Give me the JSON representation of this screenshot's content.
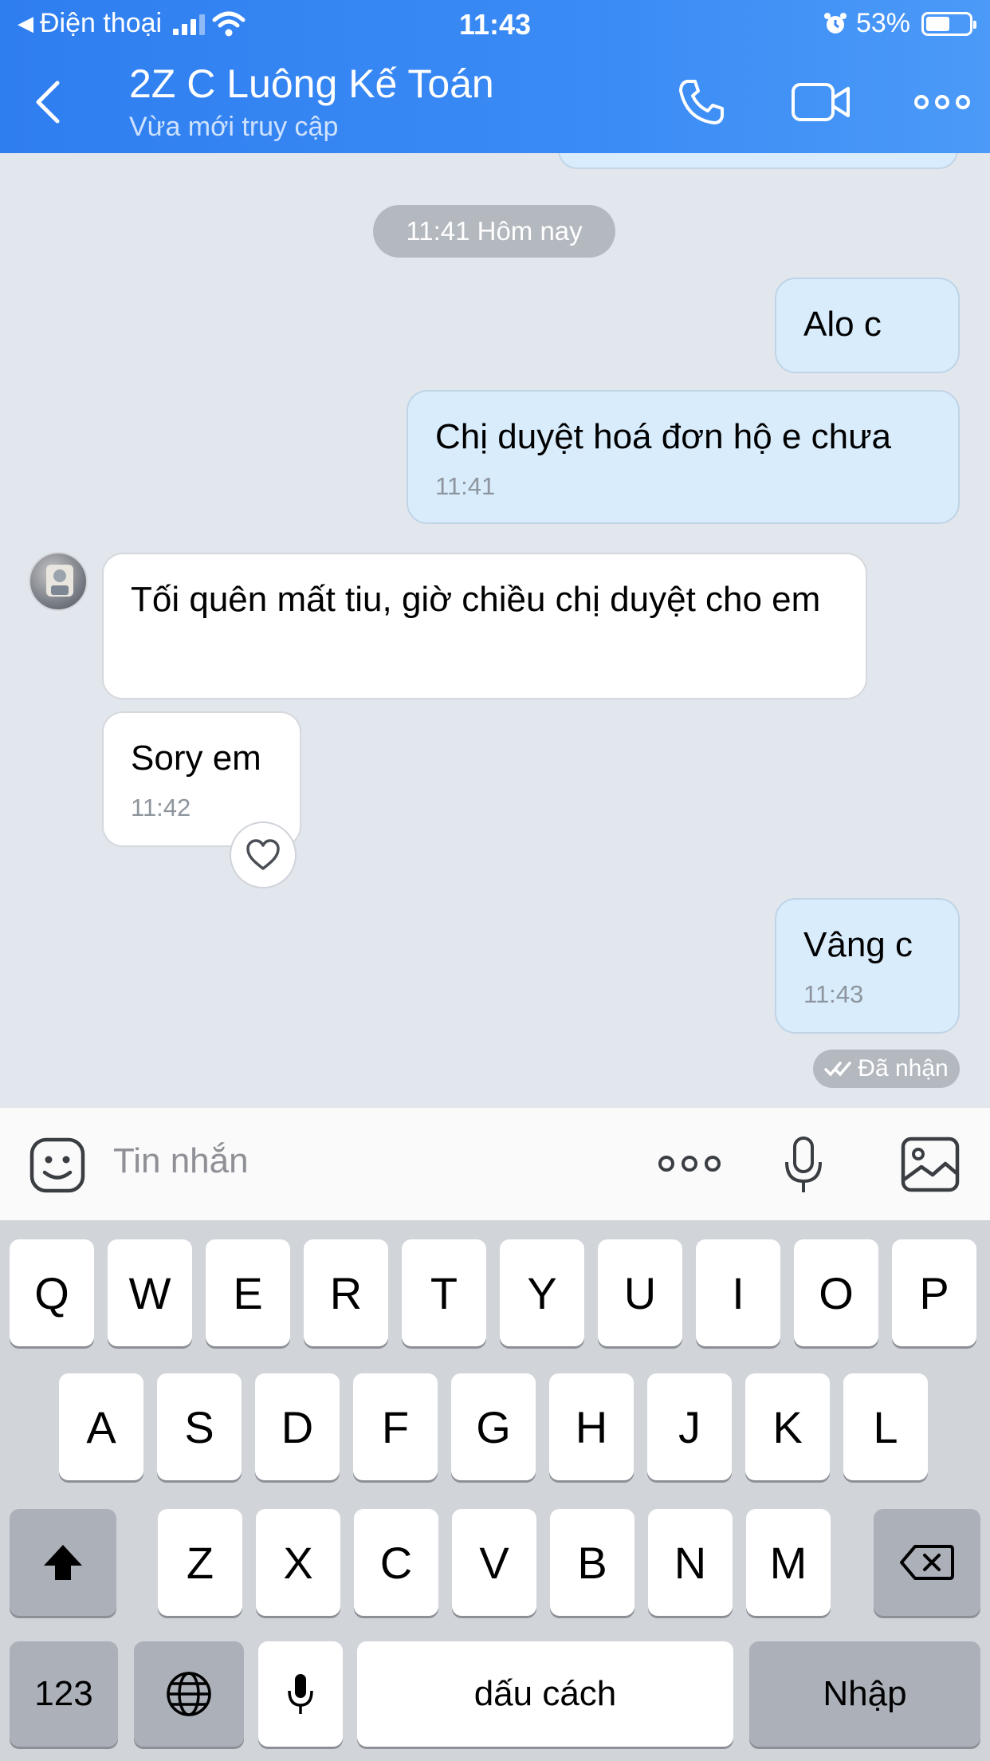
{
  "status_bar": {
    "back_app": "Điện thoại",
    "time": "11:43",
    "battery": "53%"
  },
  "header": {
    "title": "2Z C Luông Kế Toán",
    "subtitle": "Vừa mới truy cập",
    "icons": [
      "back-icon",
      "phone-icon",
      "video-camera-icon",
      "more-icon"
    ]
  },
  "chat": {
    "date_divider": "11:41 Hôm nay",
    "messages": [
      {
        "dir": "out",
        "text": "Alo c",
        "time": ""
      },
      {
        "dir": "out",
        "text": "Chị duyệt hoá đơn hộ e chưa",
        "time": "11:41"
      },
      {
        "dir": "in",
        "text": "Tối quên mất tiu, giờ chiều chị duyệt cho em",
        "time": ""
      },
      {
        "dir": "in",
        "text": "Sory em",
        "time": "11:42"
      },
      {
        "dir": "out",
        "text": "Vâng c",
        "time": "11:43"
      }
    ],
    "receipt": "Đã nhận"
  },
  "input": {
    "placeholder": "Tin nhắn",
    "icons": [
      "sticker-icon",
      "more-icon",
      "microphone-icon",
      "image-icon"
    ]
  },
  "keyboard": {
    "row1": [
      "Q",
      "W",
      "E",
      "R",
      "T",
      "Y",
      "U",
      "I",
      "O",
      "P"
    ],
    "row2": [
      "A",
      "S",
      "D",
      "F",
      "G",
      "H",
      "J",
      "K",
      "L"
    ],
    "row3": [
      "Z",
      "X",
      "C",
      "V",
      "B",
      "N",
      "M"
    ],
    "numbers_key": "123",
    "space_key": "dấu cách",
    "return_key": "Nhập"
  }
}
